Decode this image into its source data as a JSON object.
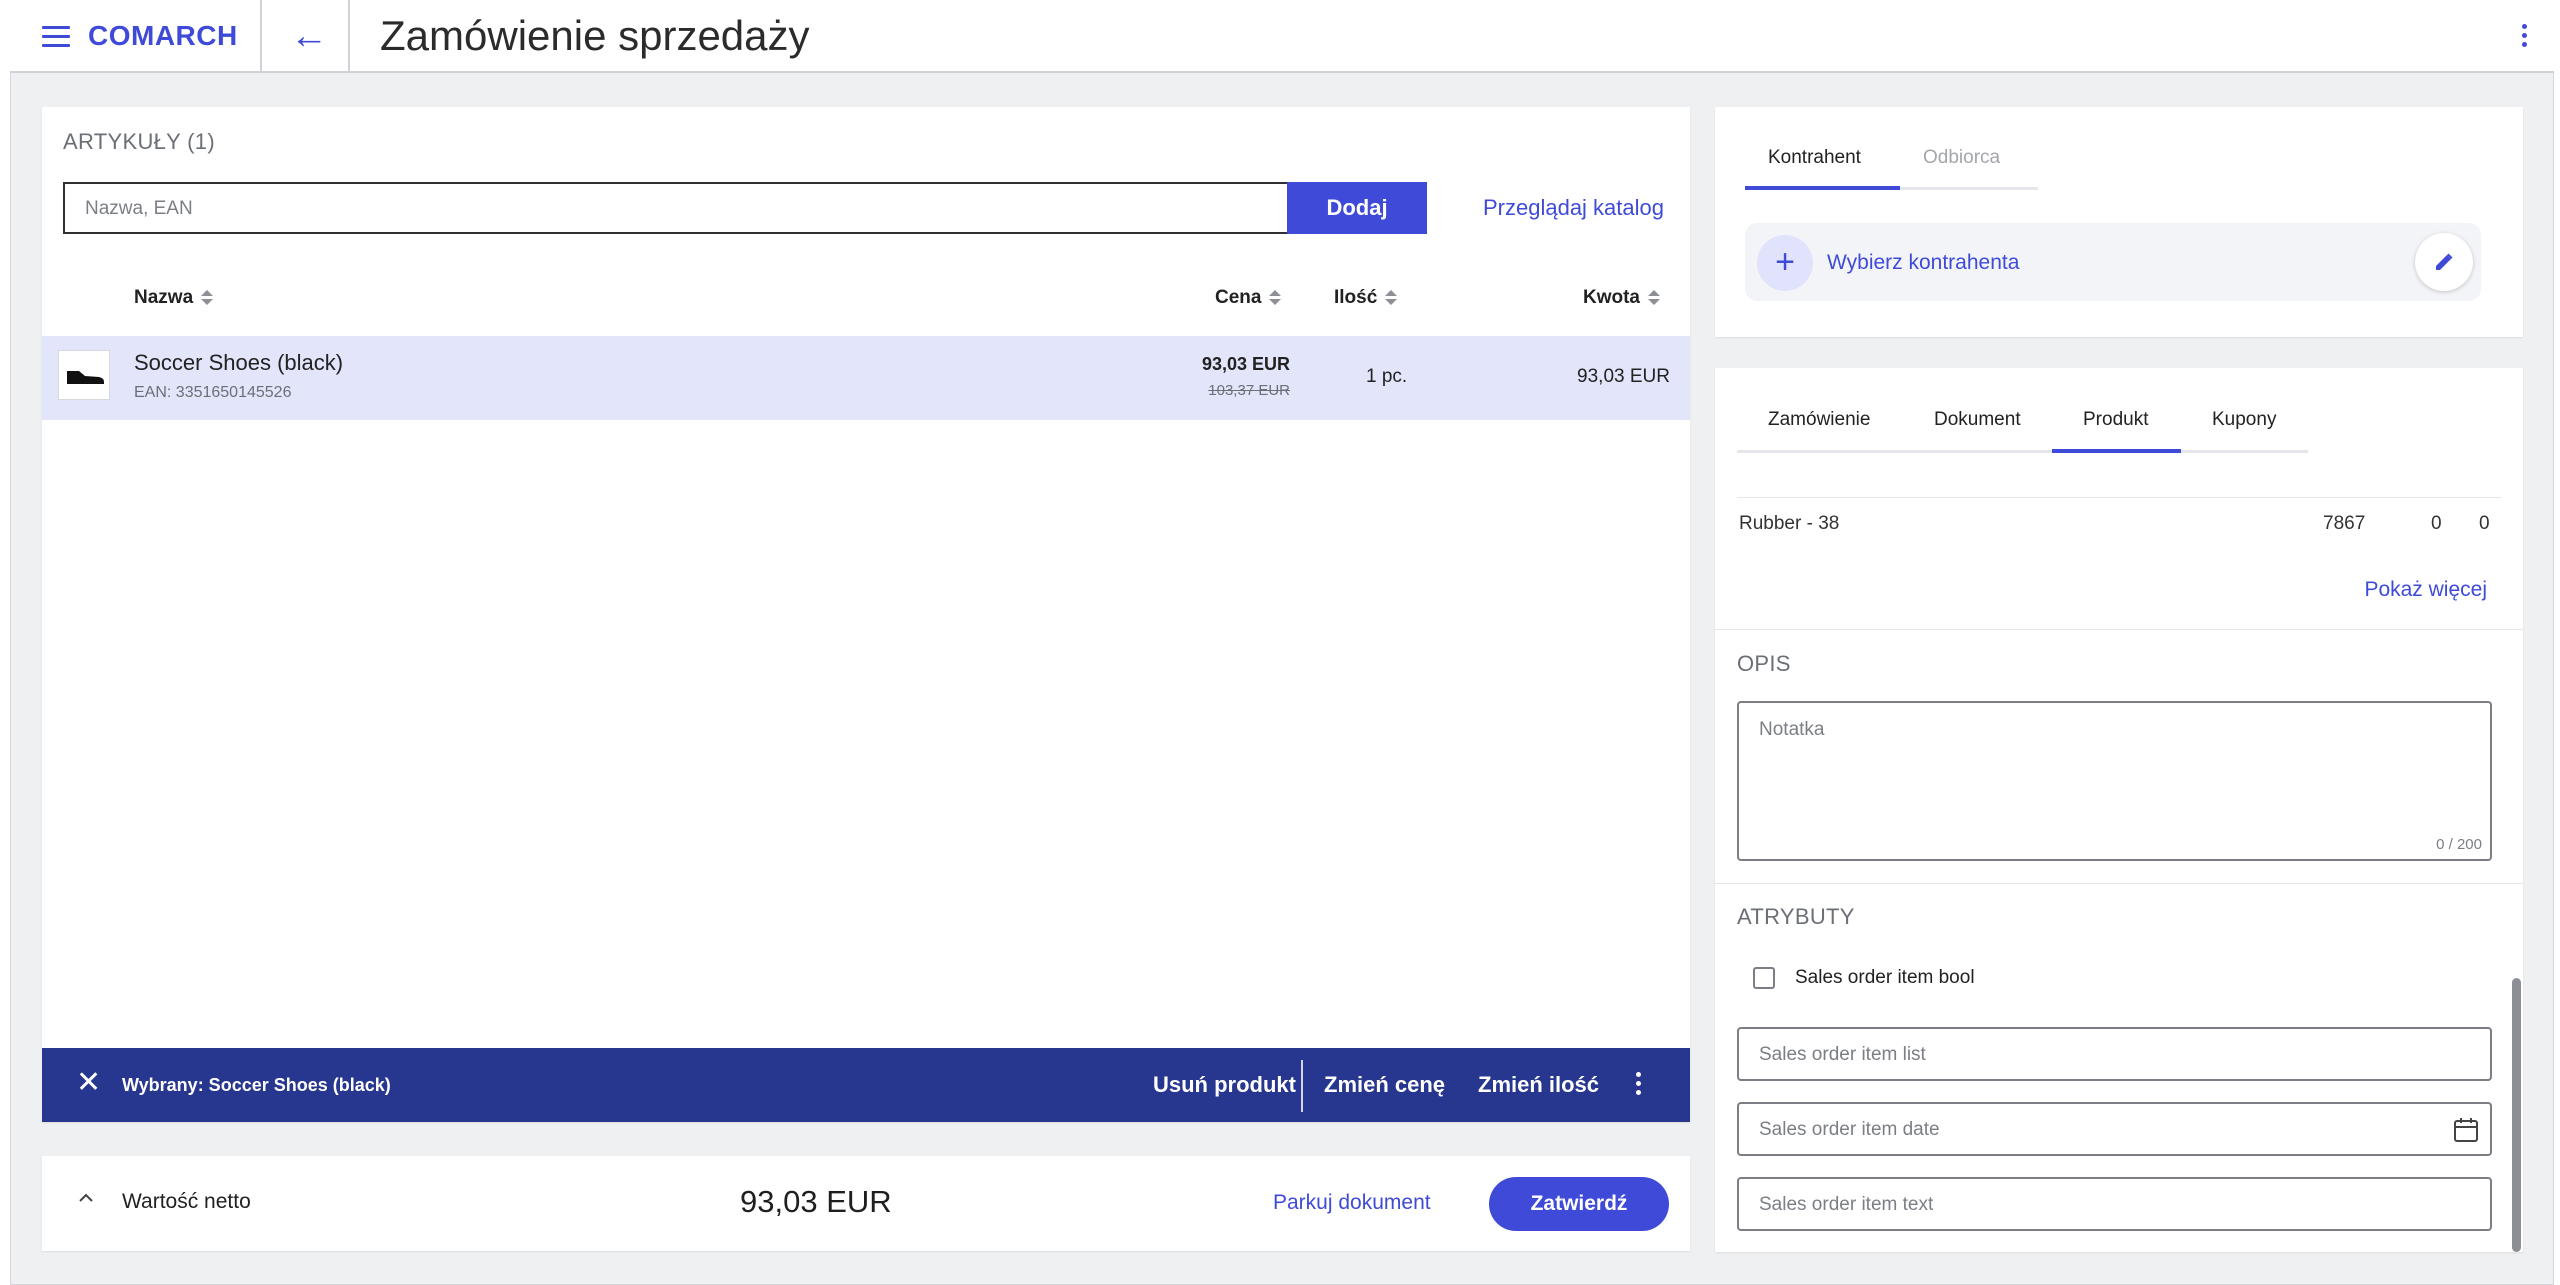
{
  "header": {
    "brand": "COMARCH",
    "title": "Zamówienie sprzedaży"
  },
  "articles": {
    "section_title": "ARTYKUŁY (1)",
    "search_placeholder": "Nazwa, EAN",
    "add_label": "Dodaj",
    "catalog_link": "Przeglądaj katalog",
    "columns": {
      "name": "Nazwa",
      "price": "Cena",
      "qty": "Ilość",
      "amount": "Kwota"
    },
    "items": [
      {
        "name": "Soccer Shoes (black)",
        "ean": "EAN: 3351650145526",
        "price": "93,03 EUR",
        "old_price": "103,37 EUR",
        "qty": "1 pc.",
        "amount": "93,03 EUR"
      }
    ],
    "selection_bar": {
      "text": "Wybrany: Soccer Shoes (black)",
      "remove": "Usuń produkt",
      "change_price": "Zmień cenę",
      "change_qty": "Zmień ilość"
    }
  },
  "summary": {
    "label": "Wartość netto",
    "value": "93,03 EUR",
    "park": "Parkuj dokument",
    "confirm": "Zatwierdź"
  },
  "contractor": {
    "tabs": [
      "Kontrahent",
      "Odbiorca"
    ],
    "active_tab": 0,
    "choose": "Wybierz kontrahenta"
  },
  "details": {
    "tabs": [
      "Zamówienie",
      "Dokument",
      "Produkt",
      "Kupony"
    ],
    "active_tab": 2,
    "row": {
      "label": "Rubber - 38",
      "v1": "7867",
      "v2": "0",
      "v3": "0"
    },
    "more": "Pokaż więcej",
    "desc_title": "OPIS",
    "note_placeholder": "Notatka",
    "note_counter": "0 / 200",
    "attr_title": "ATRYBUTY",
    "bool_label": "Sales order item bool",
    "list_placeholder": "Sales order item list",
    "date_placeholder": "Sales order item date",
    "text_placeholder": "Sales order item text"
  },
  "colors": {
    "accent": "#3f4bd8",
    "selection_bar": "#27368f",
    "row_highlight": "#e3e5fb"
  }
}
